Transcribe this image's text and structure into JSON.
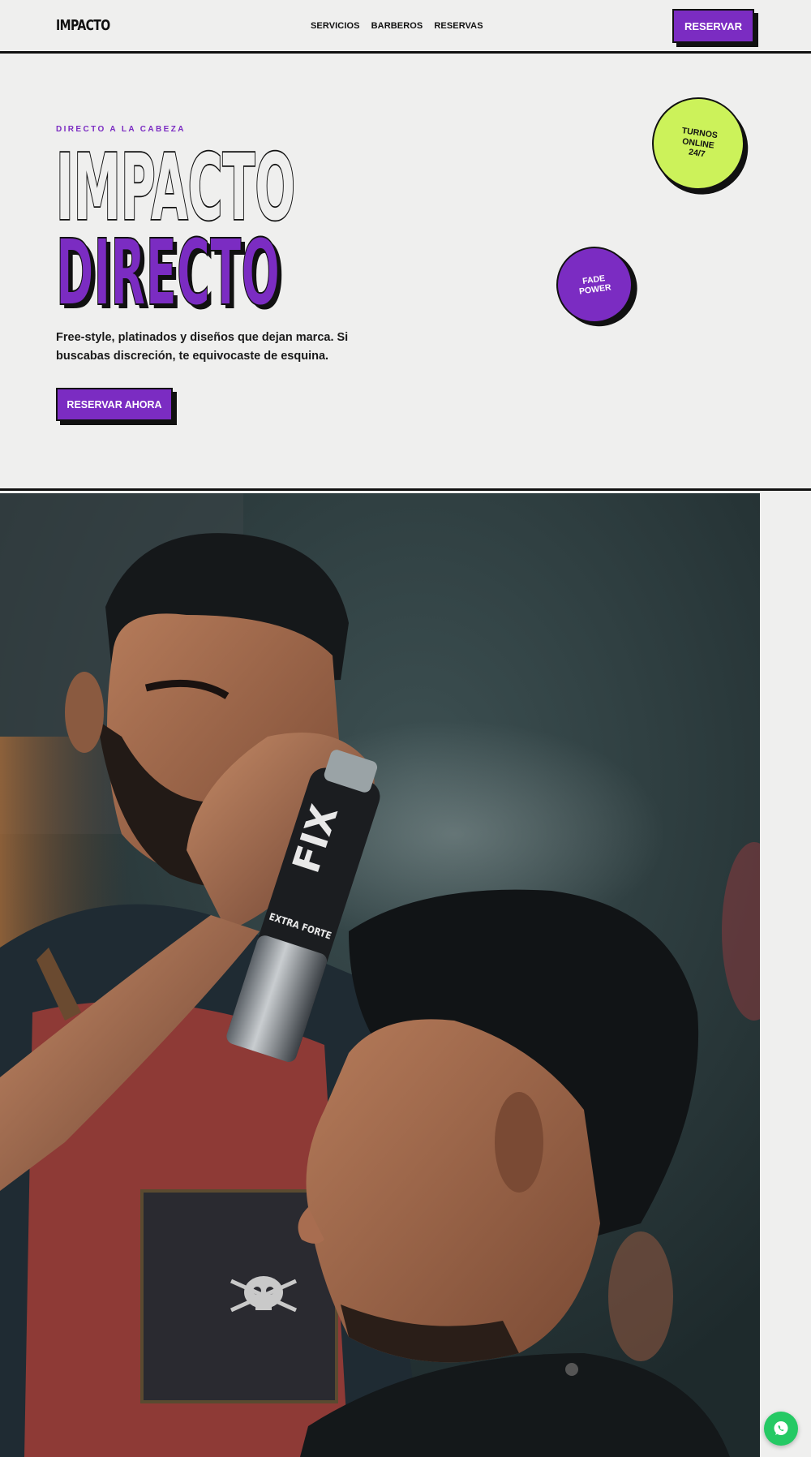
{
  "nav": {
    "logo": "IMPACTO",
    "links": [
      "SERVICIOS",
      "BARBEROS",
      "RESERVAS"
    ],
    "cta": "RESERVAR"
  },
  "hero": {
    "eyebrow": "DIRECTO A LA CABEZA",
    "title_line1": "IMPACTO",
    "title_line2": "DIRECTO",
    "description": "Free-style, platinados y diseños que dejan marca. Si buscabas discreción, te equivocaste de esquina.",
    "cta": "RESERVAR AHORA"
  },
  "badges": {
    "turnos": [
      "TURNOS",
      "ONLINE",
      "24/7"
    ],
    "fade": [
      "FADE",
      "POWER"
    ]
  },
  "photo": {
    "can_label": "FIX",
    "can_sublabel": "EXTRA FORTE"
  },
  "colors": {
    "accent_purple": "#7b2cc2",
    "accent_lime": "#ccf25a",
    "background": "#efefee",
    "ink": "#111111",
    "whatsapp_green": "#25c964"
  },
  "icons": {
    "whatsapp": "whatsapp-icon",
    "skull": "skull-icon"
  }
}
